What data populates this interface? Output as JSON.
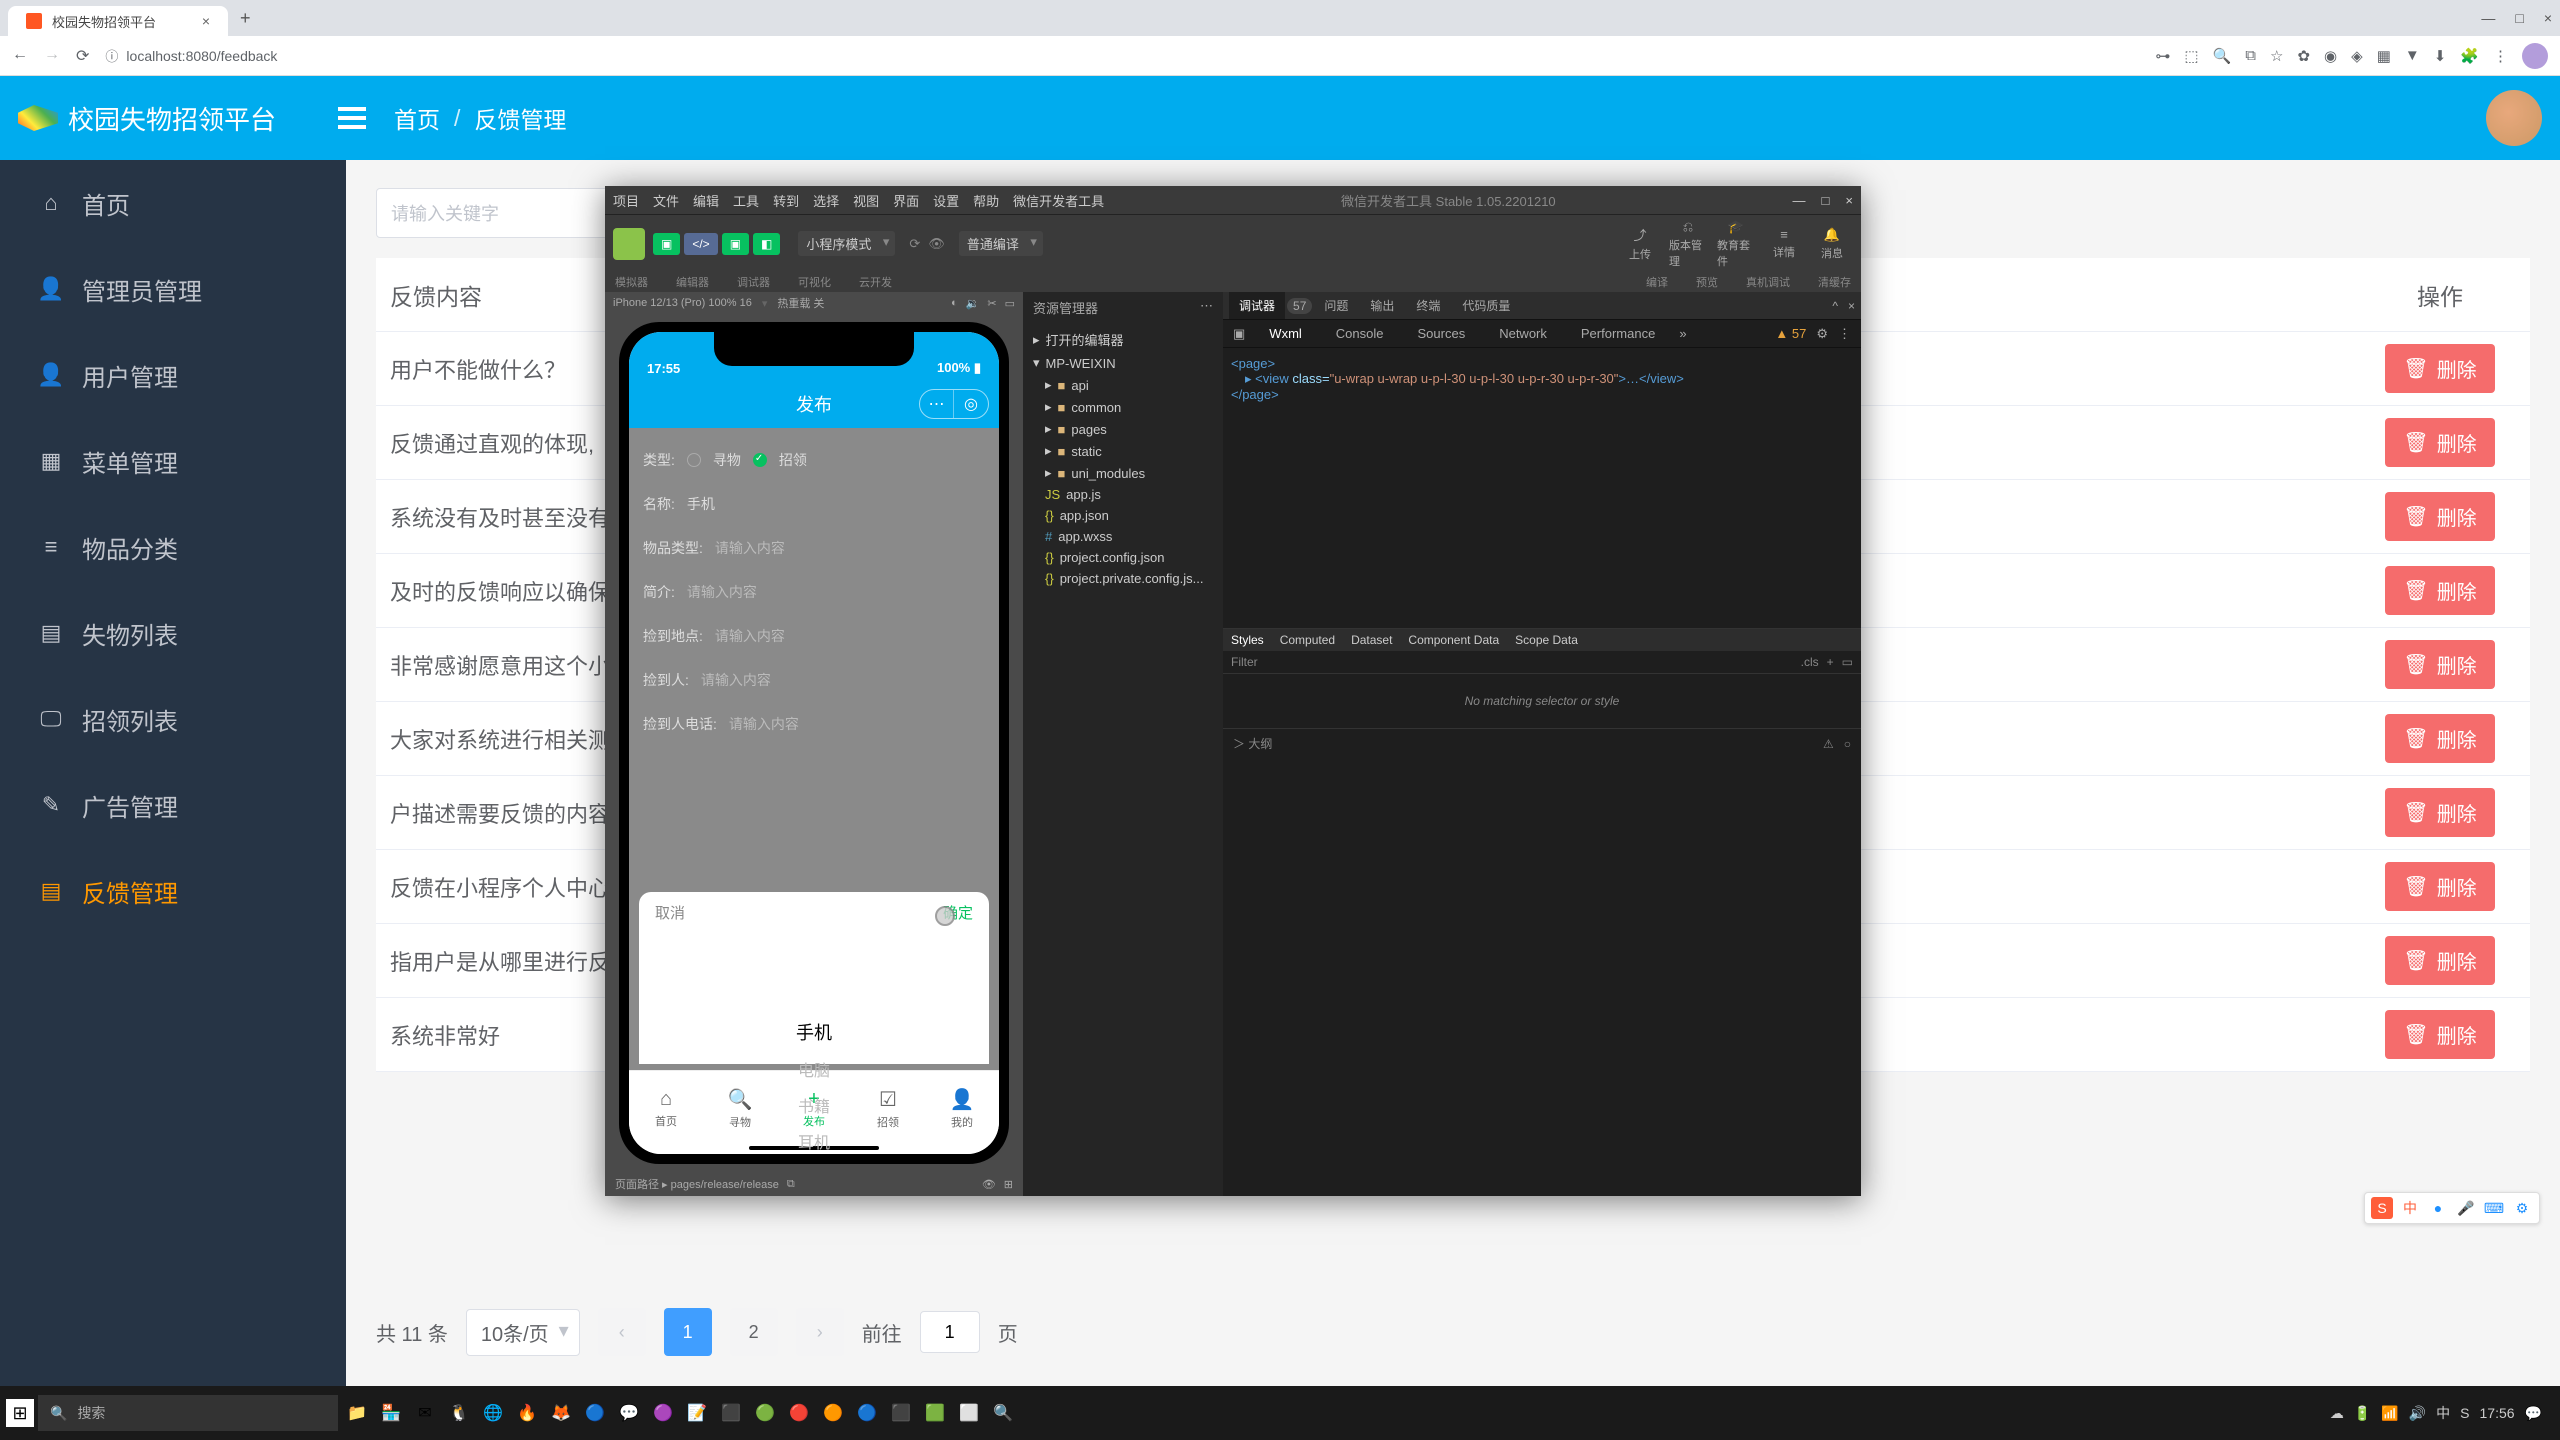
{
  "browser": {
    "tab_title": "校园失物招领平台",
    "url": "localhost:8080/feedback"
  },
  "header": {
    "logo_text": "校园失物招领平台",
    "crumb_home": "首页",
    "crumb_current": "反馈管理"
  },
  "sidebar": {
    "items": [
      {
        "icon": "⌂",
        "label": "首页"
      },
      {
        "icon": "👤",
        "label": "管理员管理"
      },
      {
        "icon": "👤",
        "label": "用户管理"
      },
      {
        "icon": "▦",
        "label": "菜单管理"
      },
      {
        "icon": "≡",
        "label": "物品分类"
      },
      {
        "icon": "▤",
        "label": "失物列表"
      },
      {
        "icon": "🖵",
        "label": "招领列表"
      },
      {
        "icon": "✎",
        "label": "广告管理"
      },
      {
        "icon": "▤",
        "label": "反馈管理"
      }
    ]
  },
  "search": {
    "placeholder": "请输入关键字"
  },
  "table": {
    "h_content": "反馈内容",
    "h_ops": "操作",
    "del": "删除",
    "rows": [
      "用户不能做什么？",
      "反馈通过直观的体现,",
      "系统没有及时甚至没有",
      "及时的反馈响应以确保",
      "非常感谢愿意用这个小",
      "大家对系统进行相关测",
      "户描述需要反馈的内容",
      "反馈在小程序个人中心",
      "指用户是从哪里进行反",
      "系统非常好"
    ]
  },
  "pagination": {
    "total": "共 11 条",
    "per": "10条/页",
    "p1": "1",
    "p2": "2",
    "goto": "前往",
    "page": "1",
    "unit": "页"
  },
  "taskbar": {
    "search": "搜索",
    "time": "17:56"
  },
  "devtools": {
    "menus": [
      "项目",
      "文件",
      "编辑",
      "工具",
      "转到",
      "选择",
      "视图",
      "界面",
      "设置",
      "帮助",
      "微信开发者工具"
    ],
    "title": "微信开发者工具 Stable 1.05.2201210",
    "mode_sel": "小程序模式",
    "compile_sel": "普通编译",
    "sub_labels": [
      "模拟器",
      "编辑器",
      "调试器",
      "可视化",
      "云开发"
    ],
    "sub_labels2": [
      "编译",
      "预览",
      "真机调试",
      "清缓存"
    ],
    "sub_labels3": [
      "上传",
      "版本管理",
      "教育套件",
      "详情",
      "消息"
    ],
    "sim_device": "iPhone 12/13 (Pro) 100% 16",
    "sim_net": "热重载 关",
    "ios_time": "17:55",
    "ios_batt": "100%",
    "nav_title": "发布",
    "form": {
      "type_label": "类型:",
      "type_a": "寻物",
      "type_b": "招领",
      "name_label": "名称:",
      "name_val": "手机",
      "wptype_label": "物品类型:",
      "ph": "请输入内容",
      "intro_label": "简介:",
      "loc_label": "捡到地点:",
      "person_label": "捡到人:",
      "phone_label": "捡到人电话:"
    },
    "picker": {
      "cancel": "取消",
      "ok": "确定",
      "opts": [
        "手机",
        "电脑",
        "书籍",
        "耳机"
      ]
    },
    "tabs": [
      "首页",
      "寻物",
      "发布",
      "招领",
      "我的"
    ],
    "page_path": "页面路径 ▸   pages/release/release",
    "explorer": {
      "title": "资源管理器",
      "open": "打开的编辑器",
      "root": "MP-WEIXIN",
      "items": [
        "api",
        "common",
        "pages",
        "static",
        "uni_modules",
        "app.js",
        "app.json",
        "app.wxss",
        "project.config.json",
        "project.private.config.js..."
      ]
    },
    "inspector": {
      "outer_tabs": [
        "调试器",
        "57",
        "问题",
        "输出",
        "终端",
        "代码质量"
      ],
      "tabs": [
        "Wxml",
        "Console",
        "Sources",
        "Network",
        "Performance"
      ],
      "warn": "▲ 57",
      "dom_l1": "<page>",
      "dom_l2": "▸ <view class=\"u-wrap u-wrap u-p-l-30 u-p-l-30 u-p-r-30 u-p-r-30\">…</view>",
      "dom_l3": "</page>",
      "style_tabs": [
        "Styles",
        "Computed",
        "Dataset",
        "Component Data",
        "Scope Data"
      ],
      "filter": "Filter",
      "cls": ".cls",
      "empty": "No matching selector or style",
      "console": "＞ 大纲"
    }
  }
}
